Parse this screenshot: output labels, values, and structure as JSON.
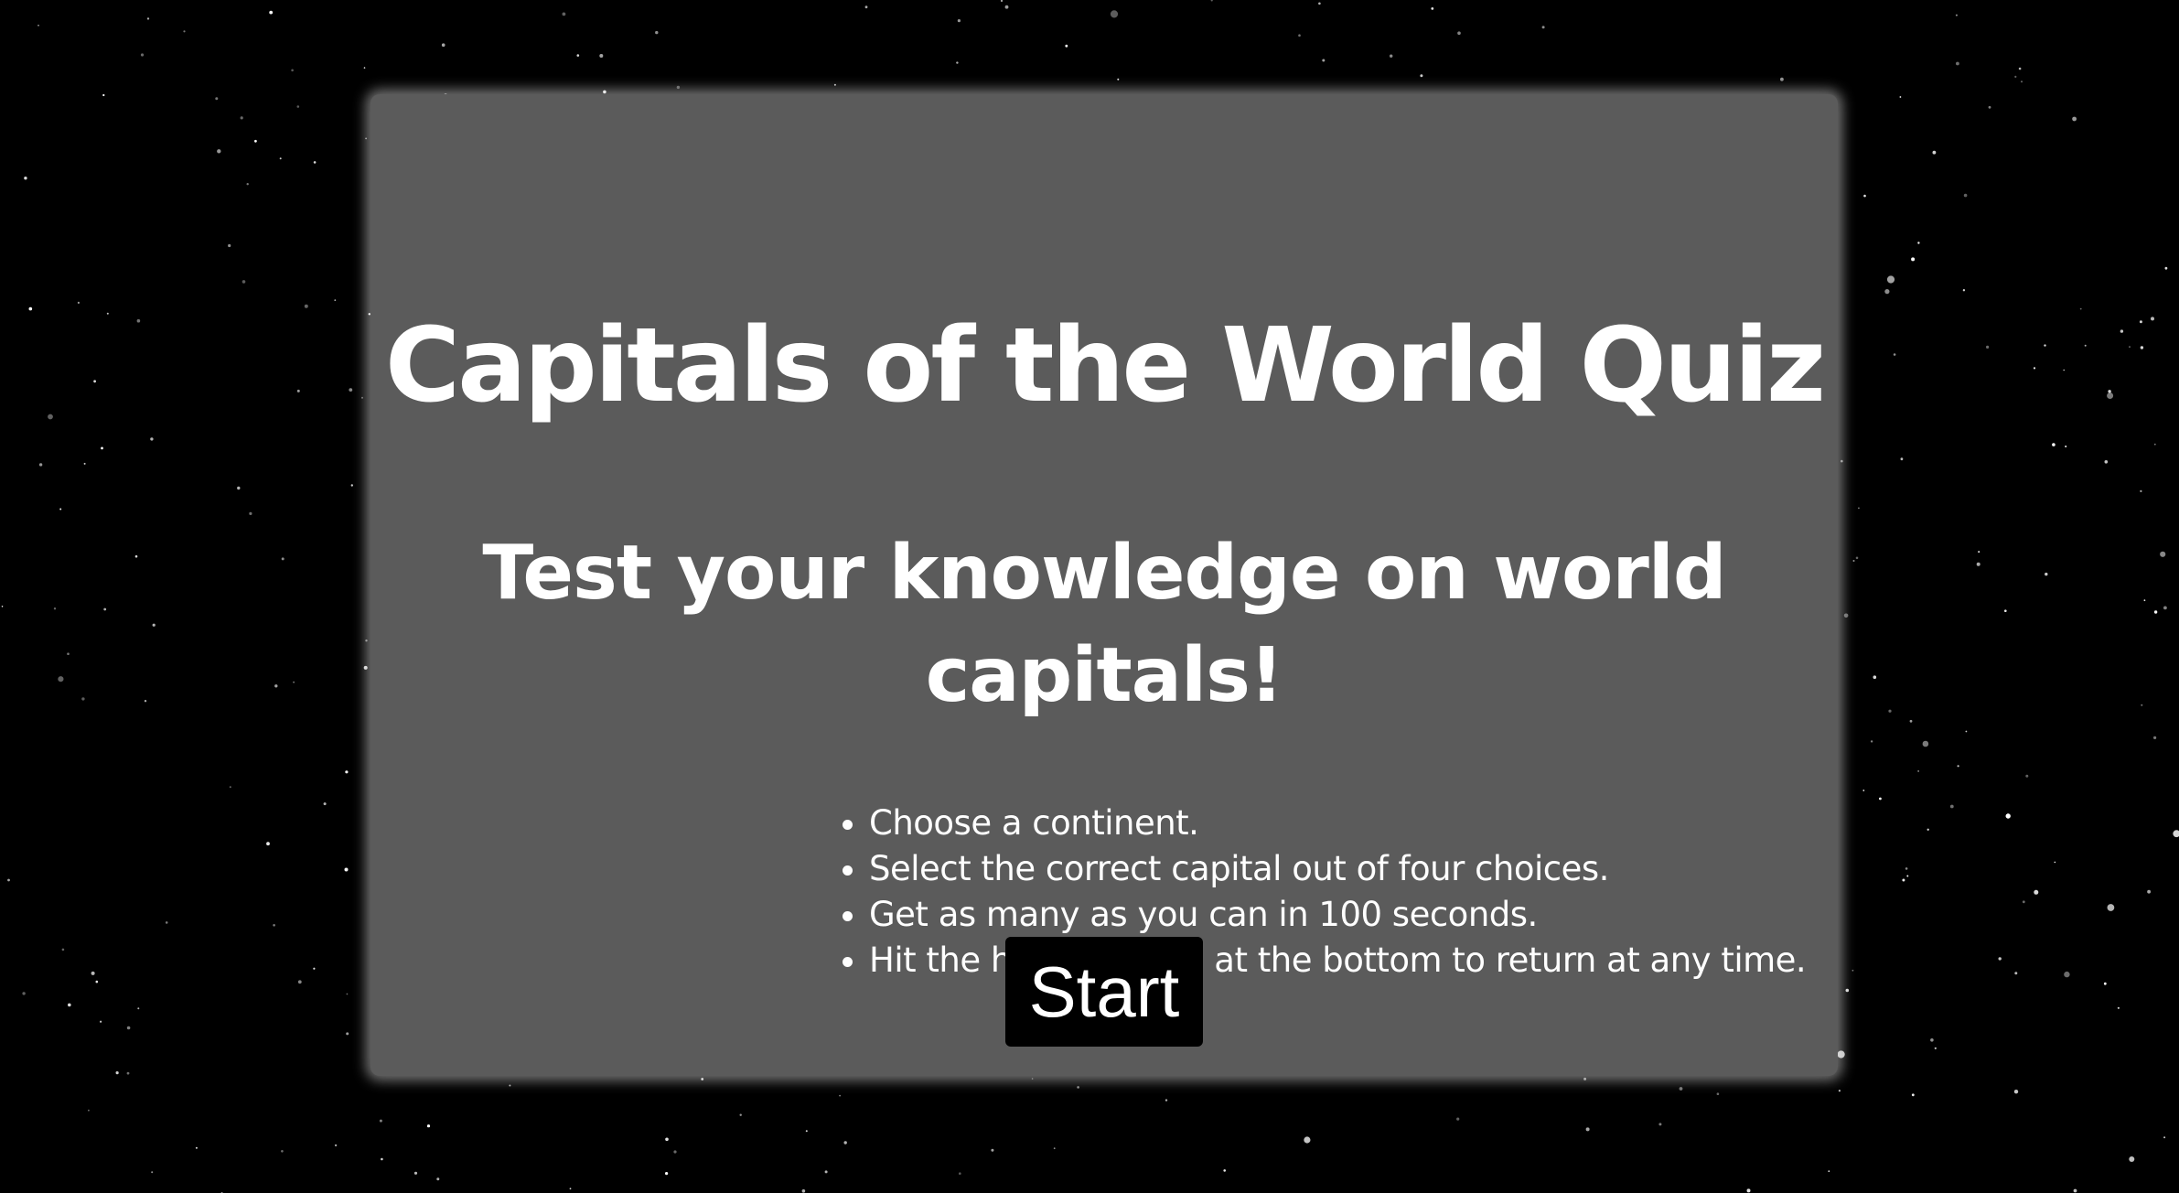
{
  "colors": {
    "background": "#000000",
    "card": "#5b5b5b",
    "text": "#ffffff",
    "button": "#000000"
  },
  "quiz": {
    "title": "Capitals of the World Quiz",
    "subtitle": "Test your knowledge on world capitals!",
    "rules": [
      "Choose a continent.",
      "Select the correct capital out of four choices.",
      "Get as many as you can in 100 seconds.",
      "Hit the home button at the bottom to return at any time."
    ],
    "start_label": "Start"
  }
}
